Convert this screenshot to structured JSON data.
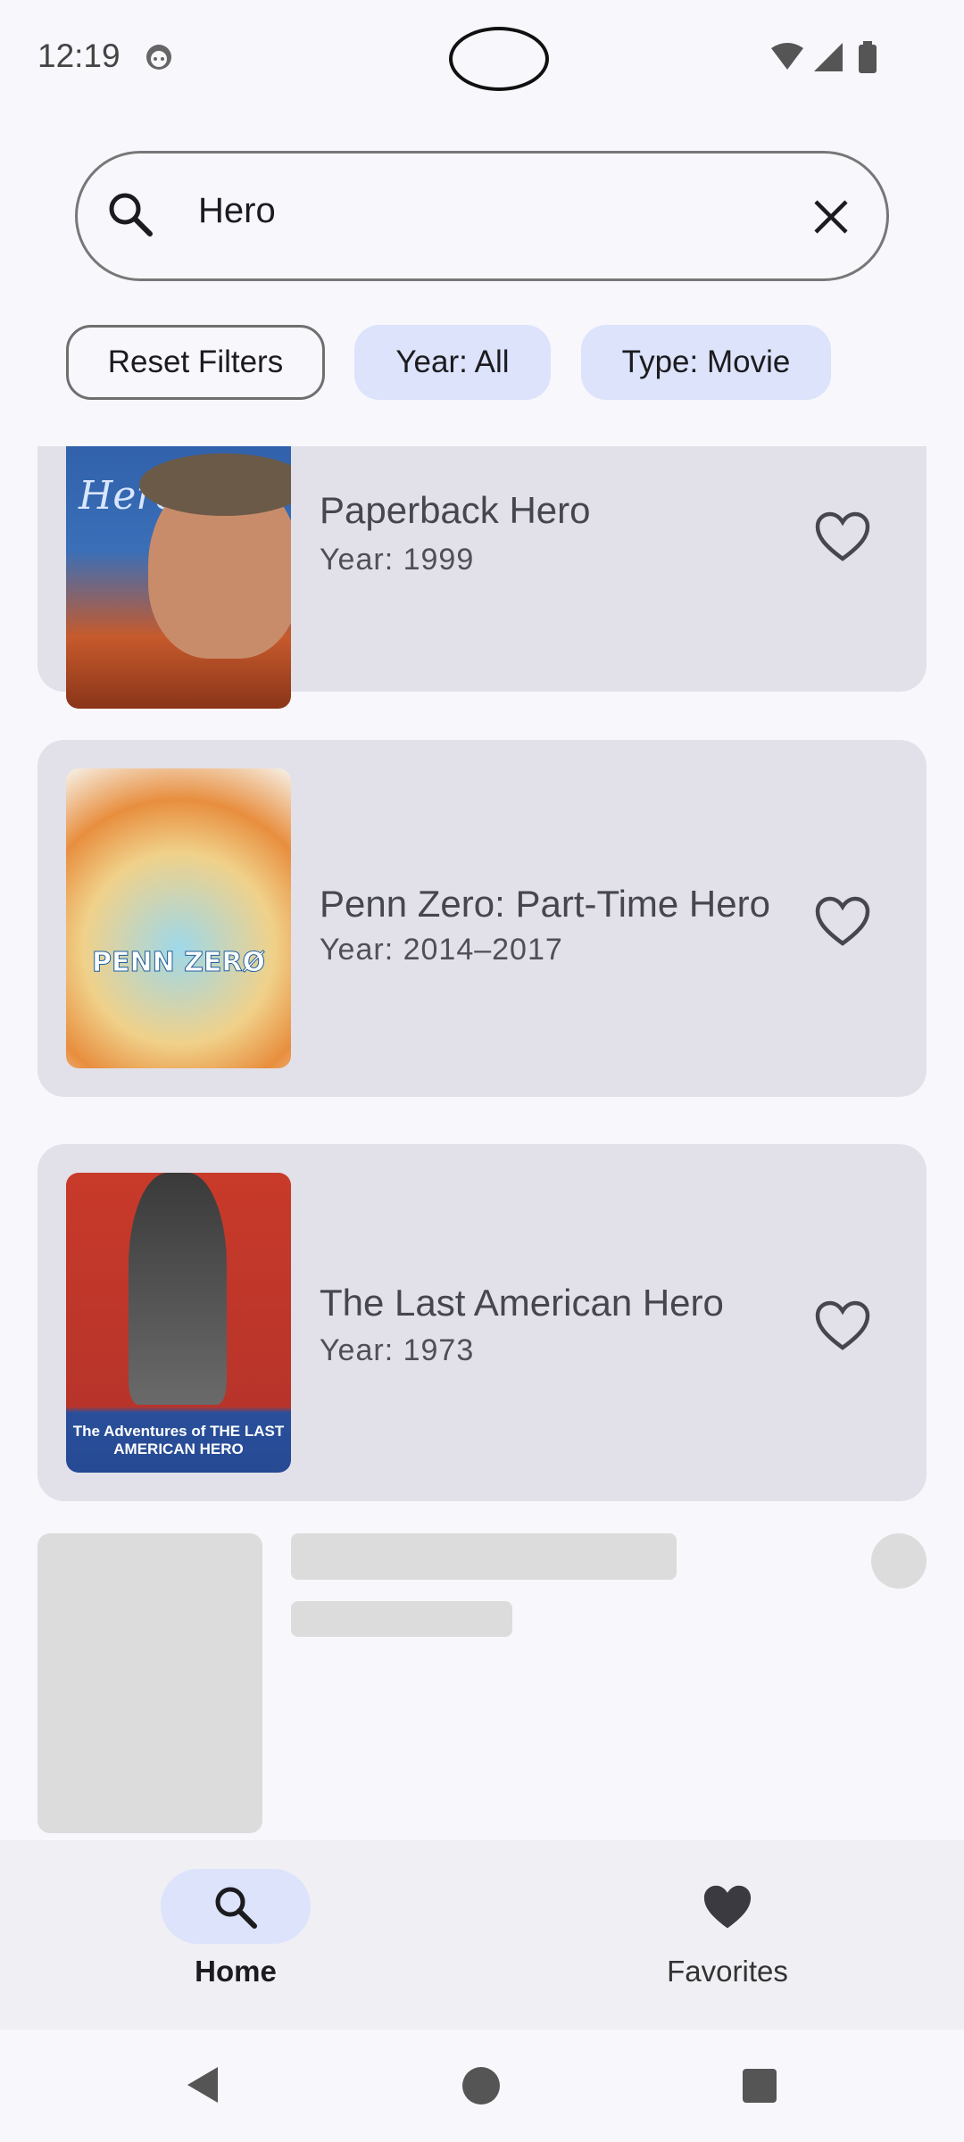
{
  "status": {
    "time": "12:19"
  },
  "search": {
    "query": "Hero"
  },
  "filters": {
    "reset_label": "Reset Filters",
    "year_label": "Year: All",
    "type_label": "Type: Movie"
  },
  "results": [
    {
      "title": "Paperback Hero",
      "year": "Year: 1999",
      "favorite": false,
      "poster_text": "Hero"
    },
    {
      "title": "Penn Zero: Part-Time Hero",
      "year": "Year: 2014–2017",
      "favorite": false,
      "poster_text": "PENN ZERØ"
    },
    {
      "title": "The Last American Hero",
      "year": "Year: 1973",
      "favorite": false,
      "poster_text": "The Adventures of THE LAST AMERICAN HERO"
    }
  ],
  "bottom_nav": {
    "home_label": "Home",
    "favorites_label": "Favorites"
  },
  "colors": {
    "accent_pill": "#dce3fb",
    "card_bg": "#e2e1e9",
    "background": "#f8f7fc"
  }
}
